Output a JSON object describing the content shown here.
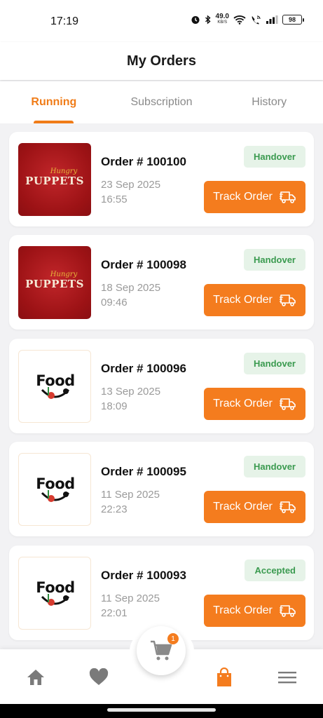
{
  "status_bar": {
    "time": "17:19",
    "net_speed": "49.0",
    "net_unit": "KB/S",
    "battery": "98"
  },
  "header": {
    "title": "My Orders"
  },
  "tabs": [
    {
      "label": "Running",
      "active": true
    },
    {
      "label": "Subscription",
      "active": false
    },
    {
      "label": "History",
      "active": false
    }
  ],
  "orders": [
    {
      "restaurant_logo": "hungry-puppets-logo",
      "logo_text_1": "Hungry",
      "logo_text_2": "PUPPETS",
      "order_number": "Order # 100100",
      "date": "23 Sep 2025",
      "time": "16:55",
      "status": "Handover",
      "action": "Track Order"
    },
    {
      "restaurant_logo": "hungry-puppets-logo",
      "logo_text_1": "Hungry",
      "logo_text_2": "PUPPETS",
      "order_number": "Order # 100098",
      "date": "18 Sep 2025",
      "time": "09:46",
      "status": "Handover",
      "action": "Track Order"
    },
    {
      "restaurant_logo": "food-logo",
      "logo_text_1": "Food",
      "order_number": "Order # 100096",
      "date": "13 Sep 2025",
      "time": "18:09",
      "status": "Handover",
      "action": "Track Order"
    },
    {
      "restaurant_logo": "food-logo",
      "logo_text_1": "Food",
      "order_number": "Order # 100095",
      "date": "11 Sep 2025",
      "time": "22:23",
      "status": "Handover",
      "action": "Track Order"
    },
    {
      "restaurant_logo": "food-logo",
      "logo_text_1": "Food",
      "order_number": "Order # 100093",
      "date": "11 Sep 2025",
      "time": "22:01",
      "status": "Accepted",
      "action": "Track Order"
    }
  ],
  "bottom_nav": {
    "items": [
      "home-icon",
      "heart-icon",
      "cart-icon",
      "shopping-bag-icon",
      "menu-icon"
    ],
    "cart_count": "1",
    "active": "shopping-bag-icon"
  },
  "colors": {
    "accent": "#f47c1e",
    "status_green": "#3a9a4f",
    "status_green_bg": "#e6f3e8",
    "muted": "#9a9a9a"
  }
}
